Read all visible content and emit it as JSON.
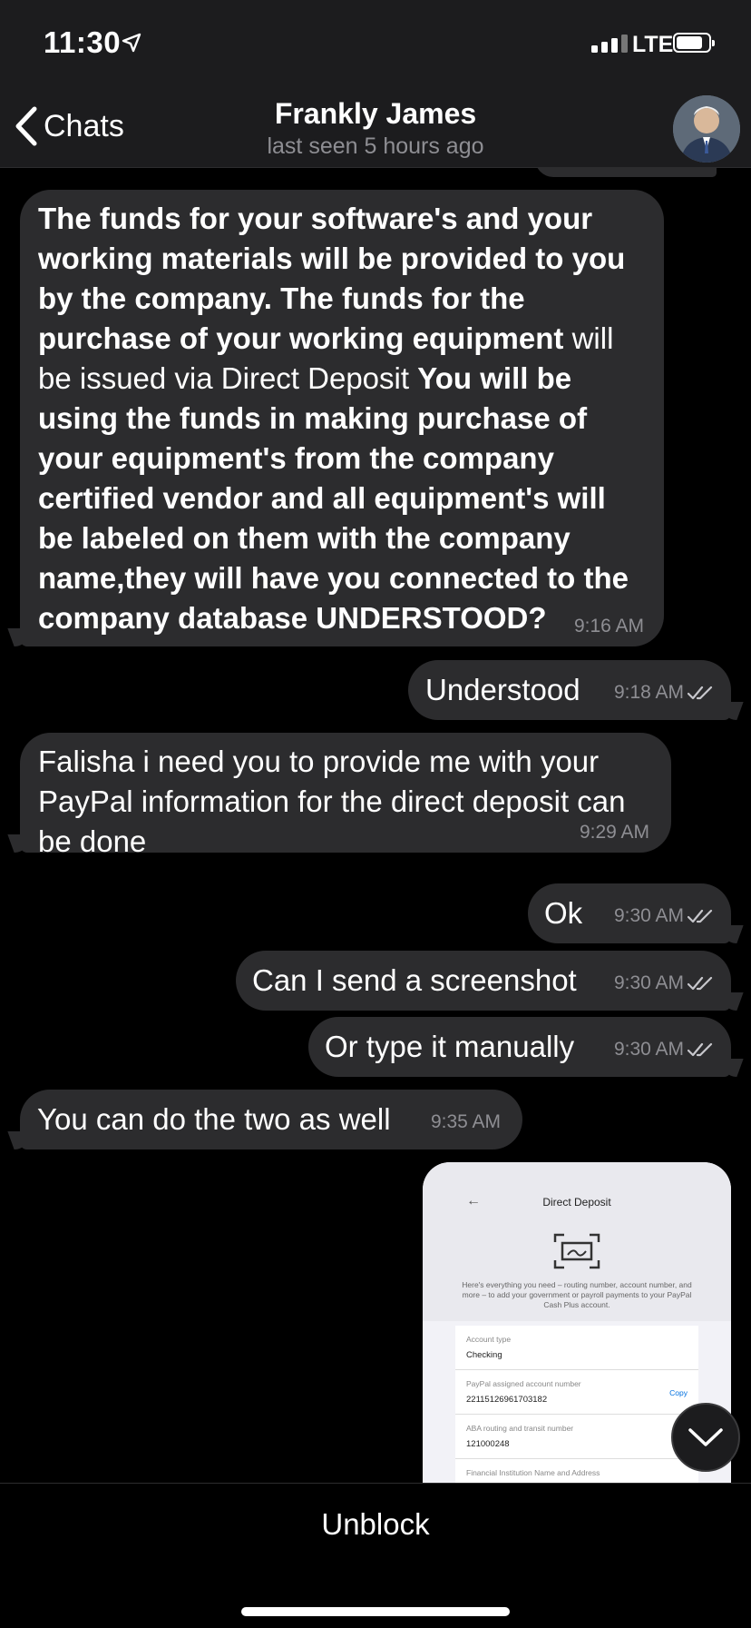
{
  "status_bar": {
    "time": "11:30",
    "network": "LTE"
  },
  "header": {
    "back_label": "Chats",
    "title": "Frankly James",
    "subtitle": "last seen 5 hours ago"
  },
  "messages": [
    {
      "direction": "incoming",
      "text_parts": [
        "The funds for your software's and your working materials will be provided to you by the company. The funds for the purchase of your working equipment",
        " will be issued via Direct Deposit ",
        "You will be using the funds in making purchase of your equipment's from the company certified vendor and all equipment's will be labeled on them with the company name,they will have you connected to the company database UNDERSTOOD?"
      ],
      "time": "9:16 AM"
    },
    {
      "direction": "outgoing",
      "text": "Understood",
      "time": "9:18 AM"
    },
    {
      "direction": "incoming",
      "text": "Falisha i need you to provide me with your PayPal information for the direct deposit can be done",
      "time": "9:29 AM"
    },
    {
      "direction": "outgoing",
      "text": "Ok",
      "time": "9:30 AM"
    },
    {
      "direction": "outgoing",
      "text": "Can I send a screenshot",
      "time": "9:30 AM"
    },
    {
      "direction": "outgoing",
      "text": "Or type it manually",
      "time": "9:30 AM"
    },
    {
      "direction": "incoming",
      "text": "You can do the two as well",
      "time": "9:35 AM"
    }
  ],
  "image_message": {
    "title": "Direct Deposit",
    "description": "Here's everything you need – routing number, account number, and more – to add your government or payroll payments to your PayPal Cash Plus account.",
    "fields": [
      {
        "label": "Account type",
        "value": "Checking",
        "action": ""
      },
      {
        "label": "PayPal assigned account number",
        "value": "22115126961703182",
        "action": "Copy"
      },
      {
        "label": "ABA routing and transit number",
        "value": "121000248",
        "action": ""
      },
      {
        "label": "Financial Institution Name and Address",
        "value": "",
        "action": ""
      }
    ]
  },
  "bottom": {
    "action_label": "Unblock"
  },
  "colors": {
    "background": "#000000",
    "bubble": "#2c2c2e",
    "header": "#1c1c1e",
    "timestamp": "#8e8e93"
  }
}
